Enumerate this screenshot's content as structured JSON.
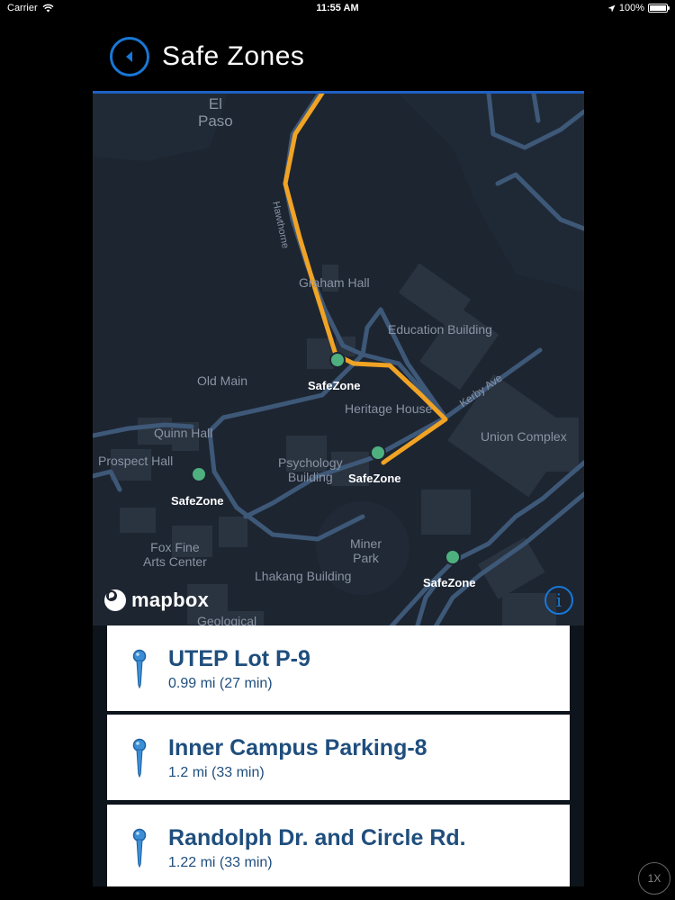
{
  "status_bar": {
    "carrier": "Carrier",
    "time": "11:55 AM",
    "battery": "100%"
  },
  "header": {
    "title": "Safe Zones"
  },
  "map": {
    "labels": {
      "el_paso": "El\nPaso",
      "graham_hall": "Graham Hall",
      "hawthorne": "Hawthorne",
      "education_building": "Education Building",
      "old_main": "Old Main",
      "heritage_house": "Heritage House",
      "kerby_ave": "Kerby Ave",
      "union_complex": "Union Complex",
      "quinn_hall": "Quinn Hall",
      "prospect_hall": "Prospect Hall",
      "psychology_building": "Psychology\nBuilding",
      "miner_park": "Miner\nPark",
      "fox_fine_arts": "Fox Fine\nArts Center",
      "lhakang_building": "Lhakang Building",
      "geological": "Geological"
    },
    "safezone_label": "SafeZone",
    "attribution": "mapbox",
    "info_glyph": "i",
    "colors": {
      "background": "#1d2531",
      "road": "#3e5878",
      "building": "#2a3340",
      "route": "#f0a324",
      "safezone_dot": "#4fb07f"
    }
  },
  "zones": [
    {
      "name": "UTEP Lot P-9",
      "detail": "0.99 mi (27 min)"
    },
    {
      "name": "Inner Campus Parking-8",
      "detail": "1.2 mi (33 min)"
    },
    {
      "name": "Randolph Dr. and Circle Rd.",
      "detail": "1.22 mi (33 min)"
    }
  ],
  "playback_speed": "1X",
  "icons": [
    "back-arrow-icon",
    "wifi-icon",
    "location-arrow-icon",
    "battery-icon",
    "mapbox-logo-icon",
    "info-icon",
    "map-pin-icon"
  ]
}
